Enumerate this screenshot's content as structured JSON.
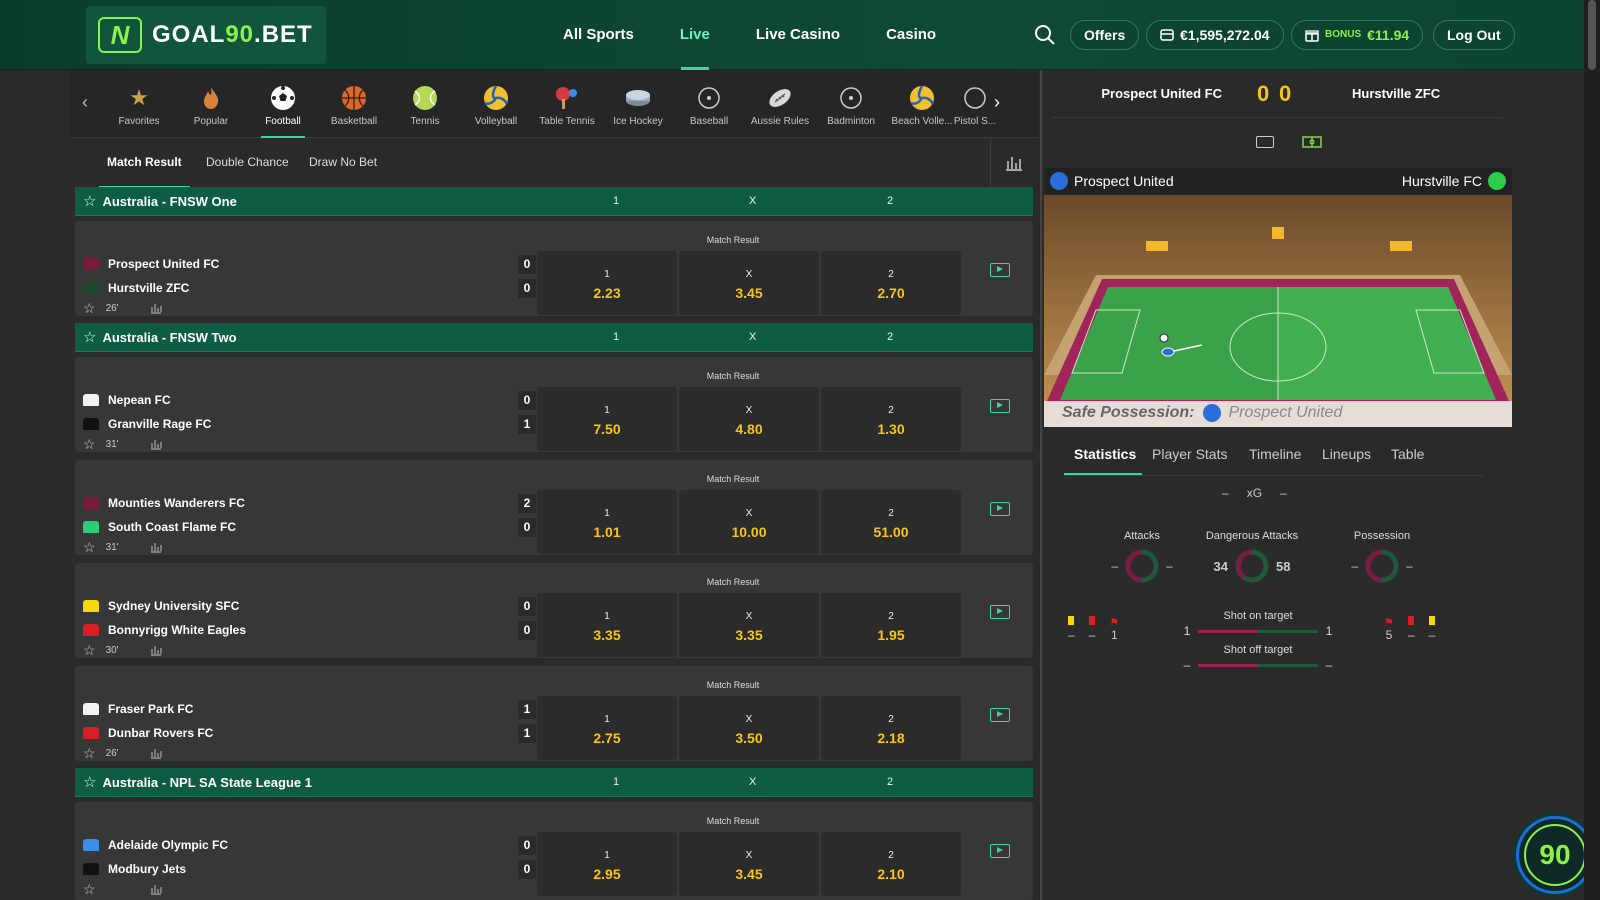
{
  "header": {
    "logo_n": "N",
    "logo_main": "GOAL",
    "logo_num": "90",
    "logo_tld": ".BET",
    "nav": [
      "All Sports",
      "Live",
      "Live Casino",
      "Casino"
    ],
    "offers": "Offers",
    "balance": "€1,595,272.04",
    "bonus_label": "BONUS",
    "bonus_value": "€11.94",
    "logout": "Log Out"
  },
  "sports": [
    "Favorites",
    "Popular",
    "Football",
    "Basketball",
    "Tennis",
    "Volleyball",
    "Table Tennis",
    "Ice Hockey",
    "Baseball",
    "Aussie Rules",
    "Badminton",
    "Beach Volle...",
    "Pistol S..."
  ],
  "subtabs": [
    "Match Result",
    "Double Chance",
    "Draw No Bet"
  ],
  "leagues": [
    {
      "name": "Australia - FNSW One",
      "h1": "1",
      "hx": "X",
      "h2": "2"
    },
    {
      "name": "Australia - FNSW Two",
      "h1": "1",
      "hx": "X",
      "h2": "2"
    },
    {
      "name": "Australia - NPL SA State League 1",
      "h1": "1",
      "hx": "X",
      "h2": "2"
    }
  ],
  "match_result_label": "Match Result",
  "matches": [
    {
      "home": "Prospect United FC",
      "away": "Hurstville ZFC",
      "hs": "0",
      "as": "0",
      "time": "26'",
      "o1": "2.23",
      "ox": "3.45",
      "o2": "2.70",
      "k1": "1",
      "kx": "X",
      "k2": "2",
      "hc": "#7a1a3a",
      "ac": "#1f4a2a"
    },
    {
      "home": "Nepean FC",
      "away": "Granville Rage FC",
      "hs": "0",
      "as": "1",
      "time": "31'",
      "o1": "7.50",
      "ox": "4.80",
      "o2": "1.30",
      "k1": "1",
      "kx": "X",
      "k2": "2",
      "hc": "#f2f2f2",
      "ac": "#111111"
    },
    {
      "home": "Mounties Wanderers FC",
      "away": "South Coast Flame FC",
      "hs": "2",
      "as": "0",
      "time": "31'",
      "o1": "1.01",
      "ox": "10.00",
      "o2": "51.00",
      "k1": "1",
      "kx": "X",
      "k2": "2",
      "hc": "#7a1a3a",
      "ac": "#2dcc7a"
    },
    {
      "home": "Sydney University SFC",
      "away": "Bonnyrigg White Eagles",
      "hs": "0",
      "as": "0",
      "time": "30'",
      "o1": "3.35",
      "ox": "3.35",
      "o2": "1.95",
      "k1": "1",
      "kx": "X",
      "k2": "2",
      "hc": "#f5d90a",
      "ac": "#d81f26"
    },
    {
      "home": "Fraser Park FC",
      "away": "Dunbar Rovers FC",
      "hs": "1",
      "as": "1",
      "time": "26'",
      "o1": "2.75",
      "ox": "3.50",
      "o2": "2.18",
      "k1": "1",
      "kx": "X",
      "k2": "2",
      "hc": "#f2f2f2",
      "ac": "#d81f26"
    },
    {
      "home": "Adelaide Olympic FC",
      "away": "Modbury Jets",
      "hs": "0",
      "as": "0",
      "time": "",
      "o1": "2.95",
      "ox": "3.45",
      "o2": "2.10",
      "k1": "1",
      "kx": "X",
      "k2": "2",
      "hc": "#3a8ee8",
      "ac": "#111111"
    }
  ],
  "live": {
    "home": "Prospect United FC",
    "away": "Hurstville ZFC",
    "hs": "0",
    "as": "0",
    "field_home": "Prospect United",
    "field_away": "Hurstville FC",
    "possession_label": "Safe Possession:",
    "possession_team": "Prospect United",
    "tabs": [
      "Statistics",
      "Player Stats",
      "Timeline",
      "Lineups",
      "Table"
    ],
    "xg_label": "xG",
    "xg_home": "–",
    "xg_away": "–",
    "attacks_label": "Attacks",
    "attacks_home": "–",
    "attacks_away": "–",
    "dang_label": "Dangerous Attacks",
    "dang_home": "34",
    "dang_away": "58",
    "poss_label": "Possession",
    "poss_home": "–",
    "poss_away": "–",
    "on_target_label": "Shot on target",
    "on_target_home": "1",
    "on_target_away": "1",
    "off_target_label": "Shot off target",
    "off_target_home": "–",
    "off_target_away": "–",
    "home_yellow": "–",
    "home_red": "–",
    "home_corners": "1",
    "away_corners": "5",
    "away_red": "–",
    "away_yellow": "–"
  },
  "badge": "90",
  "colors": {
    "accent": "#39d6a0",
    "odds": "#f5c518",
    "header": "#0f4a35",
    "league": "#0e5c43",
    "lime": "#8ef04c"
  }
}
